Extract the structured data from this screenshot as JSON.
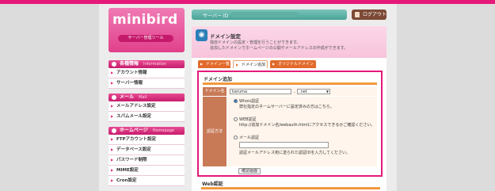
{
  "logo": {
    "brand": "minibird",
    "sub": "サーバー管理ツール"
  },
  "sidebar": {
    "sections": [
      {
        "title": "各種情報",
        "en": "Information",
        "items": [
          "アカウント情報",
          "サーバー情報"
        ]
      },
      {
        "title": "メール",
        "en": "Mail",
        "items": [
          "メールアドレス設定",
          "スパムメール設定"
        ]
      },
      {
        "title": "ホームページ",
        "en": "Homepage",
        "items": [
          "FTPアカウント設定",
          "データベース設定",
          "パスワード制限",
          "MIME設定",
          "Cron設定"
        ]
      }
    ]
  },
  "header": {
    "server_label": "サーバー ID",
    "server_value": "",
    "logout": "ログアウト"
  },
  "page": {
    "title": "ドメイン設定",
    "desc1": "独自ドメインの設定・管理を行うことができます。",
    "desc2": "追加したドメインでホームページの公開やメールアドレスの作成ができます。"
  },
  "tabs": [
    "ドメイン一覧",
    "ドメイン追加",
    "オリジナルドメイン"
  ],
  "form": {
    "section_title": "ドメイン追加",
    "domain_label": "ドメイン名",
    "domain_value": "karuma",
    "dot": ".",
    "tld": ".net",
    "auth_label": "認証方法",
    "opt_whois": "Whois認証",
    "opt_whois_note": "弊社指定のネームサーバーに設定済みの方はこちら。",
    "opt_web": "WEB認証",
    "opt_web_note": "http://追加ドメイン名/webauth.htmlにアクセスできるかご確認ください。",
    "opt_mail": "メール認証",
    "opt_mail_note": "認証メールアドレス宛に送られた認証IDを入力してください。",
    "confirm_button": "確認画面"
  },
  "web_section_title": "Web認証"
}
